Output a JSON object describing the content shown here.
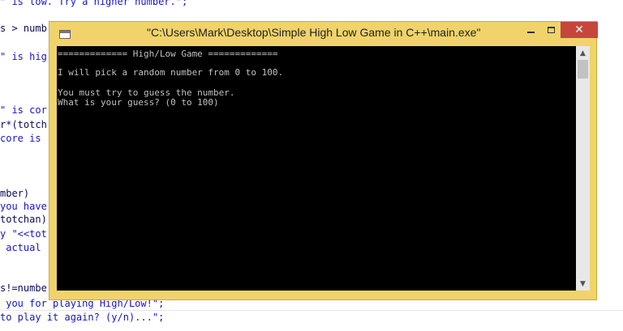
{
  "editor": {
    "lines": [
      {
        "text": "\" is low. Try a higher number.\";",
        "color": "#1515c8"
      },
      {
        "text": "s > numb",
        "color": "#0a0a5a"
      },
      {
        "text": "\" is hig",
        "color": "#1515c8"
      },
      {
        "text": "\" is cor",
        "color": "#1515c8"
      },
      {
        "text": "r*(totch",
        "color": "#0a0a5a"
      },
      {
        "text": "core is",
        "color": "#1515c8"
      },
      {
        "text": "mber)",
        "color": "#0a0a5a"
      },
      {
        "text": "you have",
        "color": "#1515c8"
      },
      {
        "text": "totchan)",
        "color": "#0a0a5a"
      },
      {
        "text": "y \"<<tot",
        "color": "#1515c8"
      },
      {
        "text": " actual",
        "color": "#1515c8"
      },
      {
        "text": "s!=numbe",
        "color": "#0a0a5a"
      },
      {
        "text": " you for playing High/Low!\";",
        "color": "#1515c8"
      },
      {
        "text": "to play it again? (y/n)...\";",
        "color": "#1515c8"
      }
    ]
  },
  "window": {
    "title": "\"C:\\Users\\Mark\\Desktop\\Simple High Low Game in C++\\main.exe\"",
    "close_glyph": "✕"
  },
  "console": {
    "lines": [
      "============= High/Low Game =============",
      "",
      "I will pick a random number from 0 to 100.",
      "",
      "You must try to guess the number.",
      "What is your guess? (0 to 100)"
    ]
  },
  "scrollbar": {
    "up_glyph": "▲",
    "down_glyph": "▼"
  }
}
